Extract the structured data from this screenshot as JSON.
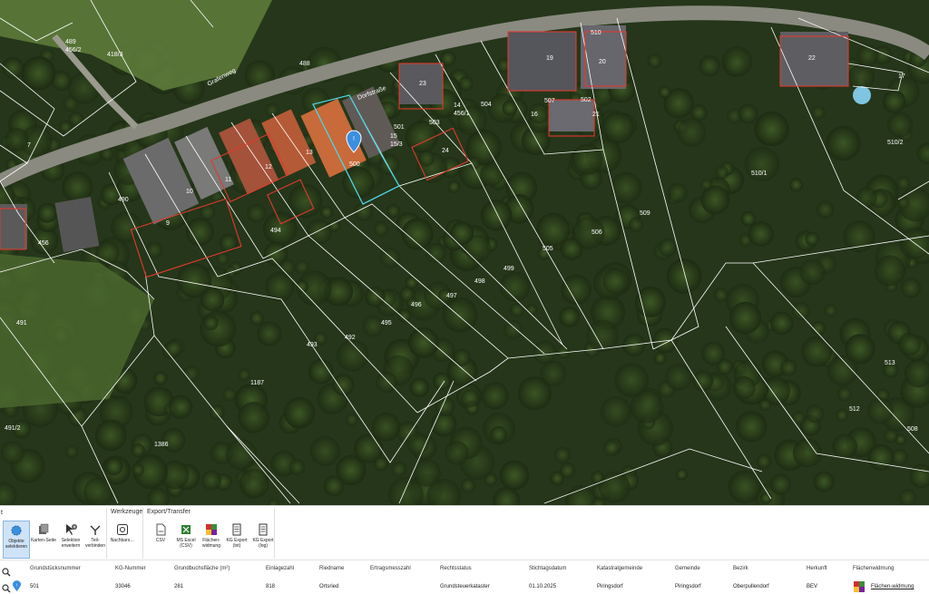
{
  "map": {
    "parcel_labels": [
      "418/3",
      "488",
      "7",
      "490",
      "489",
      "456",
      "9",
      "10",
      "11",
      "12",
      "13",
      "14",
      "15",
      "16",
      "17",
      "494",
      "493",
      "492",
      "495",
      "496",
      "497",
      "498",
      "499",
      "500",
      "501",
      "502",
      "503",
      "504",
      "505",
      "506",
      "507",
      "508",
      "509",
      "510",
      "510/1",
      "510/2",
      "513",
      "512",
      "1187",
      "1386",
      "491",
      "491/2",
      "456/2",
      "456/1",
      "15/3"
    ],
    "street_labels": [
      "Grafenweg",
      "Dorfstraße"
    ],
    "building_labels": [
      "19",
      "20",
      "21",
      "22",
      "23",
      "24"
    ],
    "marker_icon": "map-pin-icon",
    "colors": {
      "parcel_line": "#ffffff",
      "building_line": "#e03a2f",
      "selected_line": "#4fd1e0",
      "marker": "#3b8fe0"
    }
  },
  "ribbon": {
    "marker": "t",
    "groups": [
      {
        "title": ""
      },
      {
        "title": "Werkzeuge"
      },
      {
        "title": "Export/Transfer"
      }
    ],
    "buttons": [
      {
        "name": "objects-select-button",
        "label": "Objekte selektieren",
        "icon": "select-icon",
        "active": true
      },
      {
        "name": "map-page-button",
        "label": "Karten-Seite",
        "icon": "pages-icon",
        "active": false
      },
      {
        "name": "extend-selection-button",
        "label": "Selektion erweitern",
        "icon": "cursor-plus-icon",
        "active": false
      },
      {
        "name": "split-connect-button",
        "label": "Teil-verbinden",
        "icon": "merge-icon",
        "active": false
      },
      {
        "name": "neighbors-button",
        "label": "Nachbars…",
        "icon": "neighbors-icon",
        "active": false
      },
      {
        "name": "csv-button",
        "label": "CSV",
        "icon": "csv-file-icon",
        "active": false
      },
      {
        "name": "ms-excel-button",
        "label": "MS Excel (CSV)",
        "icon": "excel-icon",
        "active": false
      },
      {
        "name": "flaechenwidmung-button",
        "label": "Flächen-widmung",
        "icon": "zoning-icon",
        "active": false
      },
      {
        "name": "kg-export-txt-button",
        "label": "KG Export (txt)",
        "icon": "document-icon",
        "active": false
      },
      {
        "name": "kg-export-log-button",
        "label": "KG Export (log)",
        "icon": "document-icon",
        "active": false
      }
    ]
  },
  "table": {
    "columns": [
      "Grundstücksnummer",
      "KG-Nummer",
      "Grundbuchsfläche (m²)",
      "Einlagezahl",
      "Riedname",
      "Ertragsmesszahl",
      "Rechtsstatus",
      "Stichtagsdatum",
      "Katastralgemeinde",
      "Gemeinde",
      "Bezirk",
      "Herkunft",
      "Flächenwidmung"
    ],
    "rows": [
      [
        "501",
        "33046",
        "281",
        "818",
        "Ortsried",
        "",
        "Grundsteuerkataster",
        "01.10.2025",
        "Piringsdorf",
        "Piringsdorf",
        "Oberpullendorf",
        "BEV",
        "Flächen-widmung"
      ]
    ],
    "row_icons": [
      "zoom-icon",
      "map-pin-icon"
    ],
    "header_icon": "zoom-icon"
  }
}
